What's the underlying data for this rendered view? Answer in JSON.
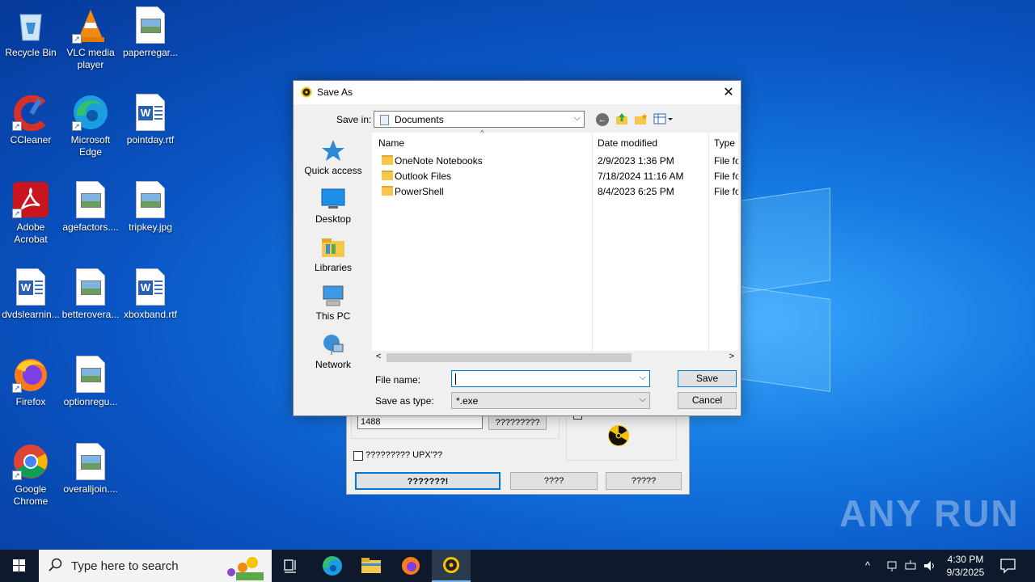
{
  "desktop": {
    "icons": [
      {
        "label": "Recycle Bin"
      },
      {
        "label": "VLC media player"
      },
      {
        "label": "paperregar..."
      },
      {
        "label": "CCleaner"
      },
      {
        "label": "Microsoft Edge"
      },
      {
        "label": "pointday.rtf"
      },
      {
        "label": "Adobe Acrobat"
      },
      {
        "label": "agefactors...."
      },
      {
        "label": "tripkey.jpg"
      },
      {
        "label": "dvdslearnin..."
      },
      {
        "label": "betterovera..."
      },
      {
        "label": "xboxband.rtf"
      },
      {
        "label": "Firefox"
      },
      {
        "label": "optionregu..."
      },
      {
        "label": "Google Chrome"
      },
      {
        "label": "overalljoin...."
      }
    ]
  },
  "background_app": {
    "input_value": "1488",
    "button_1": "?????????",
    "checkbox_label": "????????? UPX'??",
    "btn_a": "???????!",
    "btn_b": "????",
    "btn_c": "?????"
  },
  "dialog": {
    "title": "Save As",
    "save_in_label": "Save in:",
    "save_in_value": "Documents",
    "places": [
      {
        "label": "Quick access"
      },
      {
        "label": "Desktop"
      },
      {
        "label": "Libraries"
      },
      {
        "label": "This PC"
      },
      {
        "label": "Network"
      }
    ],
    "columns": {
      "name": "Name",
      "date": "Date modified",
      "type": "Type"
    },
    "files": [
      {
        "name": "OneNote Notebooks",
        "date": "2/9/2023 1:36 PM",
        "type": "File fo"
      },
      {
        "name": "Outlook Files",
        "date": "7/18/2024 11:16 AM",
        "type": "File fo"
      },
      {
        "name": "PowerShell",
        "date": "8/4/2023 6:25 PM",
        "type": "File fo"
      }
    ],
    "file_name_label": "File name:",
    "file_name_value": "",
    "save_type_label": "Save as type:",
    "save_type_value": "*.exe",
    "save_button": "Save",
    "cancel_button": "Cancel"
  },
  "taskbar": {
    "search_placeholder": "Type here to search",
    "time": "4:30 PM",
    "date": "9/3/2025"
  },
  "watermark": "ANY RUN",
  "colors": {
    "accent": "#0078d7",
    "taskbar": "#0e1a2b"
  }
}
